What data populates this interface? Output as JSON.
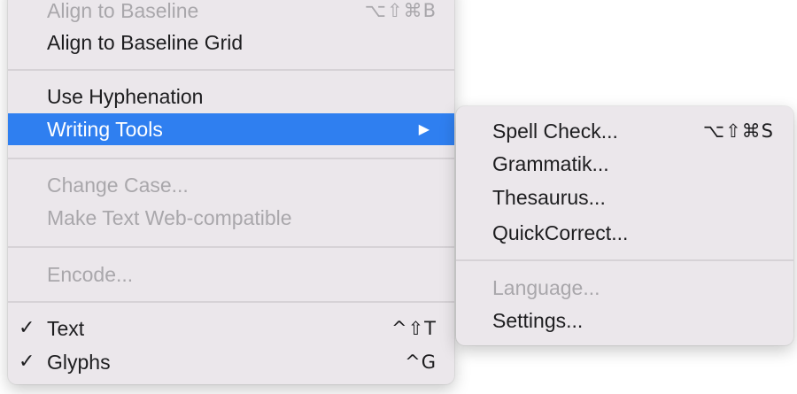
{
  "menu": {
    "align_baseline": {
      "label": "Align to Baseline",
      "shortcut": "⌥⇧⌘B"
    },
    "align_grid": {
      "label": "Align to Baseline Grid"
    },
    "use_hyphenation": {
      "label": "Use Hyphenation"
    },
    "writing_tools": {
      "label": "Writing Tools",
      "arrow": "▶"
    },
    "change_case": {
      "label": "Change Case..."
    },
    "web_compatible": {
      "label": "Make Text Web-compatible"
    },
    "encode": {
      "label": "Encode..."
    },
    "text": {
      "check": "✓",
      "label": "Text",
      "shortcut": "^⇧T"
    },
    "glyphs": {
      "check": "✓",
      "label": "Glyphs",
      "shortcut": "^G"
    }
  },
  "submenu": {
    "spell_check": {
      "label": "Spell Check...",
      "shortcut": "⌥⇧⌘S"
    },
    "grammatik": {
      "label": "Grammatik..."
    },
    "thesaurus": {
      "label": "Thesaurus..."
    },
    "quickcorrect": {
      "label": "QuickCorrect..."
    },
    "language": {
      "label": "Language..."
    },
    "settings": {
      "label": "Settings..."
    }
  },
  "colors": {
    "menu_background": "#ebe7eb",
    "highlight": "#2f7ff0",
    "text": "#1d1d1f",
    "disabled_text": "#a9a7ab",
    "separator": "#d6d2d6"
  }
}
